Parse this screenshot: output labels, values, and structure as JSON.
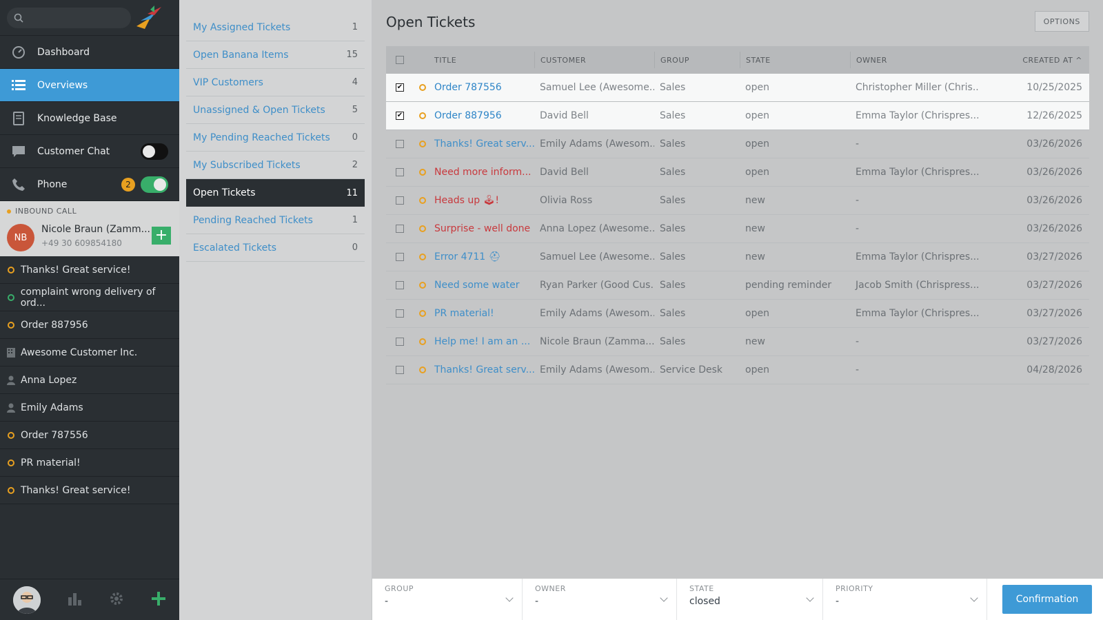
{
  "nav": {
    "items": [
      {
        "label": "Dashboard",
        "icon": "dashboard-icon"
      },
      {
        "label": "Overviews",
        "icon": "list-icon"
      },
      {
        "label": "Knowledge Base",
        "icon": "book-icon"
      },
      {
        "label": "Customer Chat",
        "icon": "chat-icon"
      },
      {
        "label": "Phone",
        "icon": "phone-icon",
        "badge": "2"
      }
    ],
    "call": {
      "header": "INBOUND CALL",
      "initials": "NB",
      "name": "Nicole Braun (Zamm...",
      "number": "+49 30 609854180",
      "add": "+"
    },
    "recent": [
      {
        "label": "Thanks! Great service!",
        "type": "ticket"
      },
      {
        "label": "complaint wrong delivery of ord...",
        "type": "ticket-green"
      },
      {
        "label": "Order 887956",
        "type": "ticket"
      },
      {
        "label": "Awesome Customer Inc.",
        "type": "org"
      },
      {
        "label": "Anna Lopez",
        "type": "user"
      },
      {
        "label": "Emily Adams",
        "type": "user"
      },
      {
        "label": "Order 787556",
        "type": "ticket"
      },
      {
        "label": "PR material!",
        "type": "ticket"
      },
      {
        "label": "Thanks! Great service!",
        "type": "ticket"
      }
    ]
  },
  "overviews": [
    {
      "label": "My Assigned Tickets",
      "count": "1"
    },
    {
      "label": "Open Banana Items",
      "count": "15"
    },
    {
      "label": "VIP Customers",
      "count": "4"
    },
    {
      "label": "Unassigned & Open Tickets",
      "count": "5"
    },
    {
      "label": "My Pending Reached Tickets",
      "count": "0"
    },
    {
      "label": "My Subscribed Tickets",
      "count": "2"
    },
    {
      "label": "Open Tickets",
      "count": "11"
    },
    {
      "label": "Pending Reached Tickets",
      "count": "1"
    },
    {
      "label": "Escalated Tickets",
      "count": "0"
    }
  ],
  "main": {
    "title": "Open Tickets",
    "options": "OPTIONS",
    "columns": {
      "title": "TITLE",
      "customer": "CUSTOMER",
      "group": "GROUP",
      "state": "STATE",
      "owner": "OWNER",
      "created": "CREATED AT ^"
    },
    "rows": [
      {
        "title": "Order 787556",
        "customer": "Samuel Lee (Awesome...",
        "group": "Sales",
        "state": "open",
        "owner": "Christopher Miller (Chris...",
        "created": "10/25/2025",
        "checked": true,
        "red": false
      },
      {
        "title": "Order 887956",
        "customer": "David Bell",
        "group": "Sales",
        "state": "open",
        "owner": "Emma Taylor (Chrispres...",
        "created": "12/26/2025",
        "checked": true,
        "red": false
      },
      {
        "title": "Thanks! Great serv...",
        "customer": "Emily Adams (Awesom...",
        "group": "Sales",
        "state": "open",
        "owner": "-",
        "created": "03/26/2026",
        "checked": false,
        "red": false
      },
      {
        "title": "Need more inform...",
        "customer": "David Bell",
        "group": "Sales",
        "state": "open",
        "owner": "Emma Taylor (Chrispres...",
        "created": "03/26/2026",
        "checked": false,
        "red": true
      },
      {
        "title": "Heads up 🕹!",
        "customer": "Olivia Ross",
        "group": "Sales",
        "state": "new",
        "owner": "-",
        "created": "03/26/2026",
        "checked": false,
        "red": true
      },
      {
        "title": "Surprise - well done",
        "customer": "Anna Lopez (Awesome...",
        "group": "Sales",
        "state": "new",
        "owner": "-",
        "created": "03/26/2026",
        "checked": false,
        "red": true
      },
      {
        "title": "Error 4711 ⛑",
        "customer": "Samuel Lee (Awesome...",
        "group": "Sales",
        "state": "new",
        "owner": "Emma Taylor (Chrispres...",
        "created": "03/27/2026",
        "checked": false,
        "red": false
      },
      {
        "title": "Need some water",
        "customer": "Ryan Parker (Good Cus...",
        "group": "Sales",
        "state": "pending reminder",
        "owner": "Jacob Smith (Chrispress...",
        "created": "03/27/2026",
        "checked": false,
        "red": false
      },
      {
        "title": "PR material!",
        "customer": "Emily Adams (Awesom...",
        "group": "Sales",
        "state": "open",
        "owner": "Emma Taylor (Chrispres...",
        "created": "03/27/2026",
        "checked": false,
        "red": false
      },
      {
        "title": "Help me! I am an ...",
        "customer": "Nicole Braun (Zamma...",
        "group": "Sales",
        "state": "new",
        "owner": "-",
        "created": "03/27/2026",
        "checked": false,
        "red": false
      },
      {
        "title": "Thanks! Great serv...",
        "customer": "Emily Adams (Awesom...",
        "group": "Service Desk",
        "state": "open",
        "owner": "-",
        "created": "04/28/2026",
        "checked": false,
        "red": false
      }
    ]
  },
  "bulk": {
    "group": {
      "label": "GROUP",
      "value": "-"
    },
    "owner": {
      "label": "OWNER",
      "value": "-"
    },
    "state": {
      "label": "STATE",
      "value": "closed"
    },
    "priority": {
      "label": "PRIORITY",
      "value": "-"
    },
    "confirm": "Confirmation"
  },
  "colors": {
    "accent": "#3e9ad6",
    "nav_bg": "#2a2f33",
    "open_state": "#e8a020",
    "green": "#38ae6a",
    "link": "#3e8ec8",
    "escalated": "#c8393d"
  }
}
